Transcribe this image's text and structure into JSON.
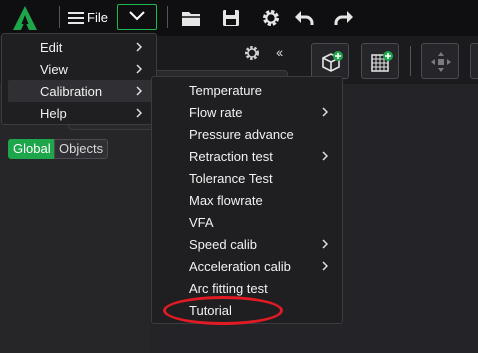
{
  "colors": {
    "accent": "#1ea64a",
    "highlight": "#e01b24",
    "menu_bg": "#1f1f22",
    "app_bg": "#242428"
  },
  "toolbar": {
    "logo": "app-logo",
    "file_label": "File",
    "icons": [
      "open-folder-icon",
      "save-icon",
      "settings-gear-icon",
      "undo-icon",
      "redo-icon"
    ]
  },
  "panel": {
    "icons": [
      "settings-gear-icon",
      "collapse-icon"
    ],
    "tabs": {
      "global": "Global",
      "objects": "Objects"
    }
  },
  "toolstrip": {
    "icons": [
      "add-object-icon",
      "add-plate-icon",
      "arrange-icon"
    ]
  },
  "main_menu": {
    "items": [
      {
        "label": "Edit",
        "has_submenu": true
      },
      {
        "label": "View",
        "has_submenu": true
      },
      {
        "label": "Calibration",
        "has_submenu": true,
        "active": true
      },
      {
        "label": "Help",
        "has_submenu": true
      }
    ]
  },
  "calibration_menu": {
    "items": [
      {
        "label": "Temperature",
        "has_submenu": false
      },
      {
        "label": "Flow rate",
        "has_submenu": true
      },
      {
        "label": "Pressure advance",
        "has_submenu": false
      },
      {
        "label": "Retraction test",
        "has_submenu": true
      },
      {
        "label": "Tolerance Test",
        "has_submenu": false
      },
      {
        "label": "Max flowrate",
        "has_submenu": false
      },
      {
        "label": "VFA",
        "has_submenu": false
      },
      {
        "label": "Speed calib",
        "has_submenu": true
      },
      {
        "label": "Acceleration calib",
        "has_submenu": true
      },
      {
        "label": "Arc fitting test",
        "has_submenu": false
      },
      {
        "label": "Tutorial",
        "has_submenu": false,
        "highlighted": true
      }
    ]
  }
}
